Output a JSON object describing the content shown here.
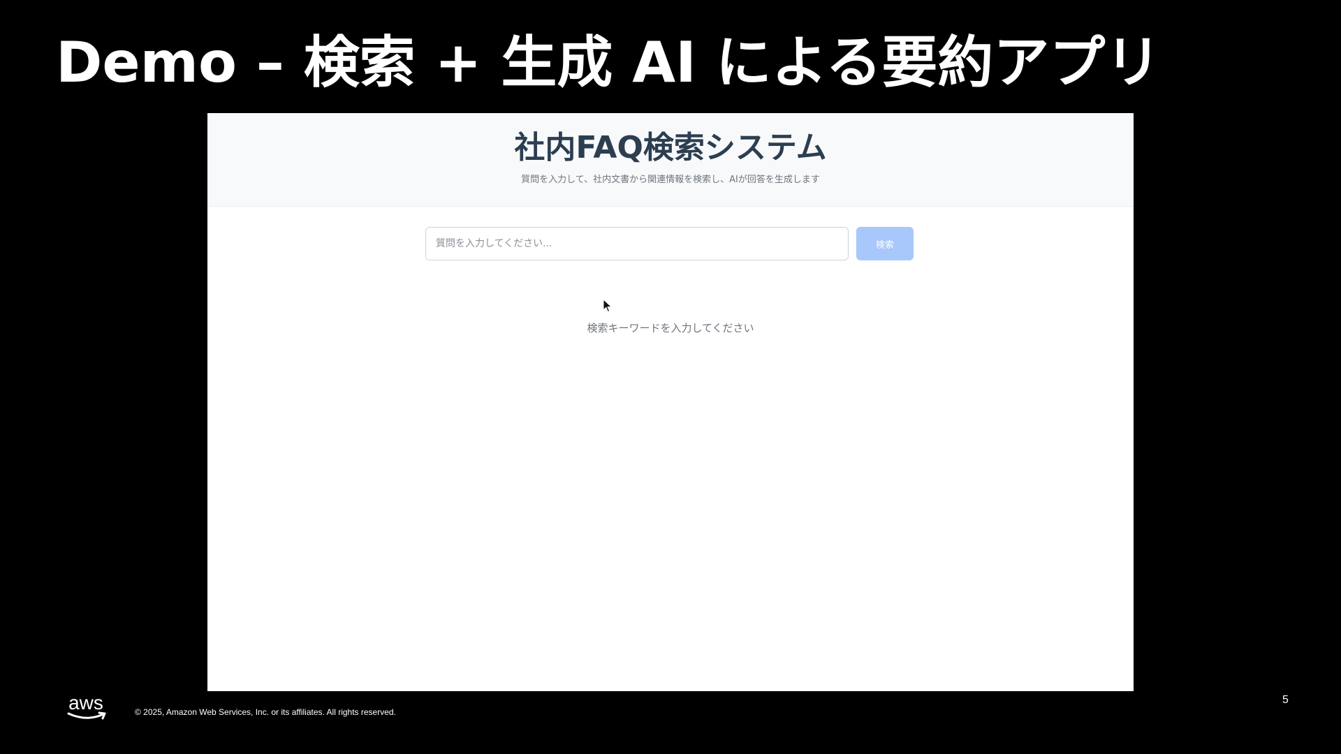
{
  "slide": {
    "title": "Demo – 検索 + 生成 AI による要約アプリ",
    "page_number": "5"
  },
  "app": {
    "title": "社内FAQ検索システム",
    "subtitle": "質問を入力して、社内文書から関連情報を検索し、AIが回答を生成します",
    "search": {
      "placeholder": "質問を入力してください...",
      "value": "",
      "button_label": "検索"
    },
    "empty_message": "検索キーワードを入力してください"
  },
  "footer": {
    "logo_text": "aws",
    "copyright": "© 2025, Amazon Web Services, Inc. or its affiliates. All rights reserved."
  },
  "icons": {
    "cursor": "mouse-pointer-icon",
    "logo_smile": "aws-smile-icon"
  },
  "colors": {
    "slide_background": "#000000",
    "slide_text": "#ffffff",
    "app_header_background": "#f8f9fa",
    "app_title": "#2c3e50",
    "muted_text": "#6c757d",
    "search_button_disabled": "#a8c7fa",
    "aws_smile": "#ffffff"
  }
}
